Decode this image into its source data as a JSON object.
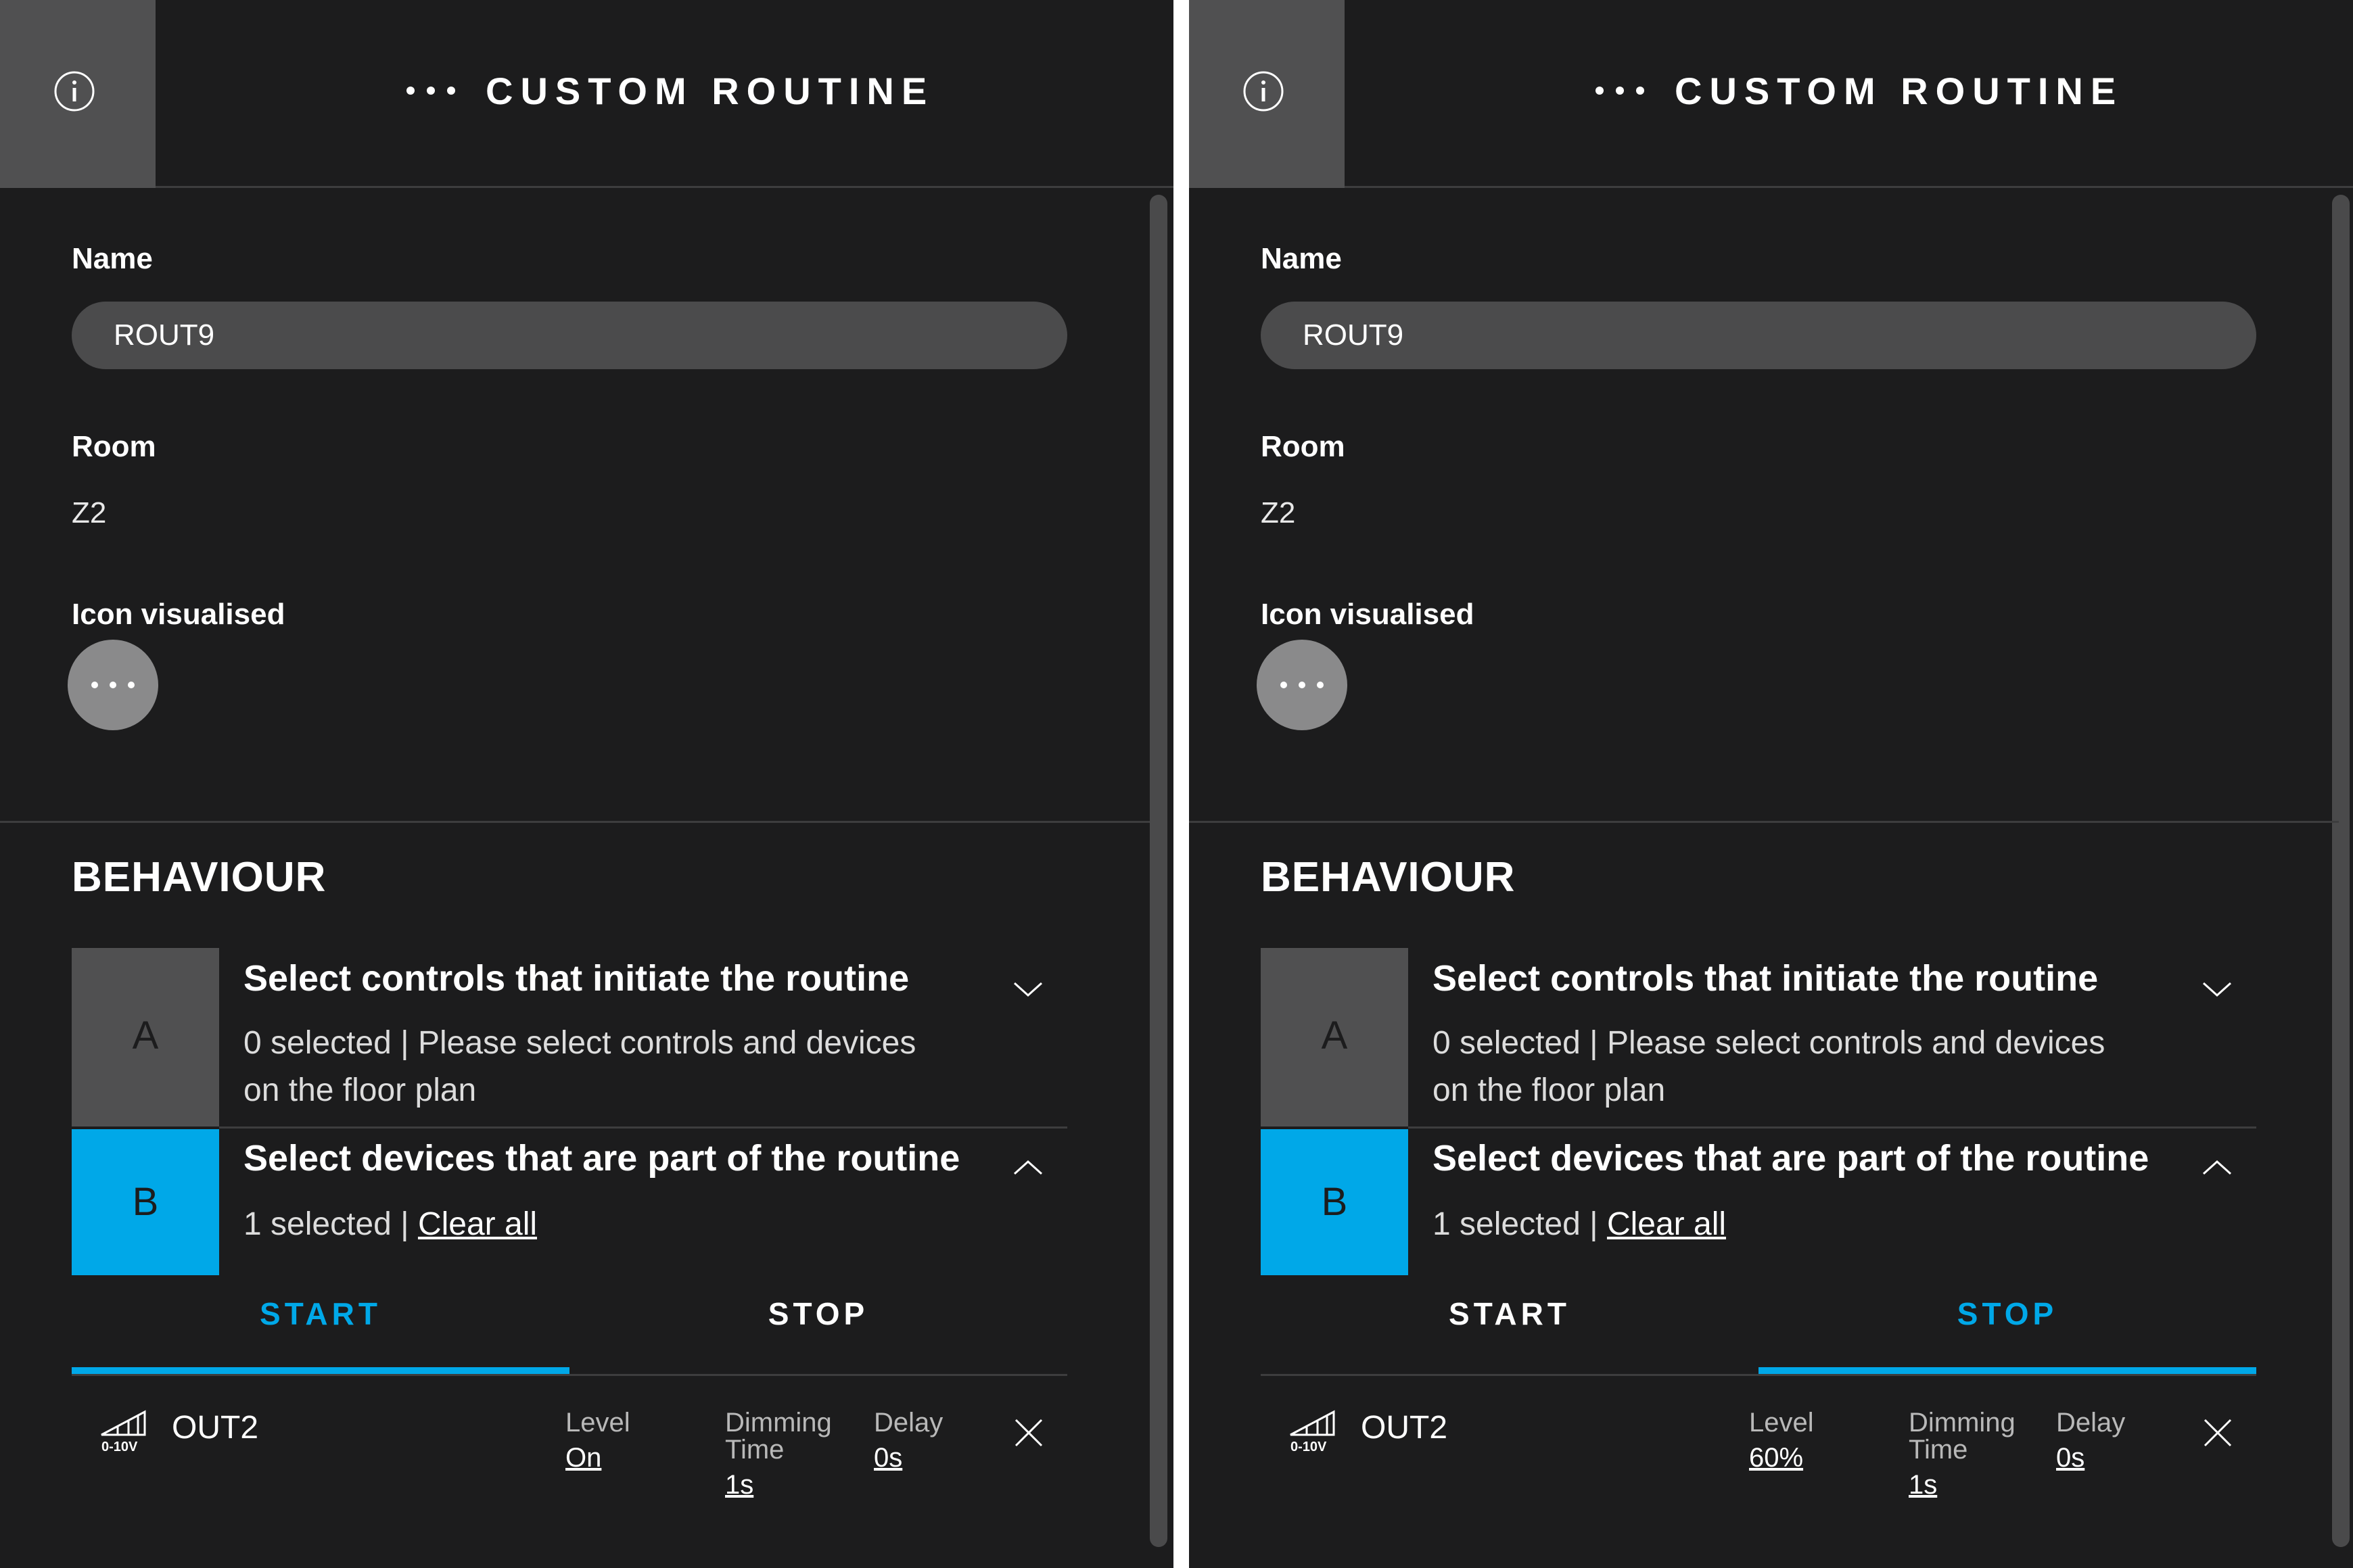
{
  "header": {
    "title": "CUSTOM ROUTINE"
  },
  "form": {
    "name_label": "Name",
    "name_value": "ROUT9",
    "room_label": "Room",
    "room_value": "Z2",
    "icon_label": "Icon visualised"
  },
  "behaviour": {
    "title": "BEHAVIOUR",
    "step_a": {
      "letter": "A",
      "title": "Select controls that initiate the routine",
      "description": "0 selected | Please select controls and devices on the floor plan"
    },
    "step_b": {
      "letter": "B",
      "title": "Select devices that are part of the routine",
      "count": "1 selected | ",
      "clear_link": "Clear all"
    }
  },
  "tabs": {
    "start": "START",
    "stop": "STOP"
  },
  "device": {
    "icon_caption": "0-10V",
    "name": "OUT2",
    "level_label": "Level",
    "dimming_label_line1": "Dimming",
    "dimming_label_line2": "Time",
    "delay_label": "Delay"
  },
  "panels": [
    {
      "active_tab": "start",
      "level_value": "On",
      "dimming_value": "1s",
      "delay_value": "0s"
    },
    {
      "active_tab": "stop",
      "level_value": "60%",
      "dimming_value": "1s",
      "delay_value": "0s"
    }
  ],
  "colors": {
    "accent": "#00a8e8",
    "background": "#1c1c1d",
    "field": "#4b4b4c",
    "header_box": "#505051"
  },
  "icons": [
    "info-icon",
    "more-dots-icon",
    "chevron-down-icon",
    "chevron-up-icon",
    "dimmer-0-10v-icon",
    "close-icon"
  ]
}
